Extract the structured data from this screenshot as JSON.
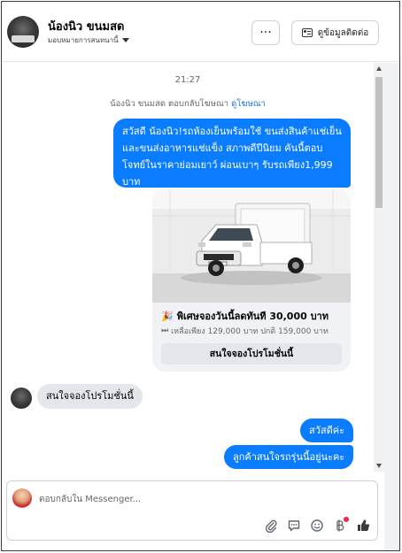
{
  "header": {
    "page_name": "น้องนิว ขนมสด",
    "page_subtitle": "มอบหมายการสนทนานี้",
    "more_label": "···",
    "contact_label": "ดูข้อมูลติดต่อ"
  },
  "chat": {
    "timestamp": "21:27",
    "replied_prefix": "น้องนิว ขนมสด ตอบกลับโฆษณา",
    "replied_link": "ดูโฆษณา",
    "outgoing_1": "สวัสดี น้องนิว!รถห้องเย็นพร้อมใช้ ขนส่งสินค้าแช่เย็นและขนส่งอาหารแช่แข็ง สภาพดีปีนิยม คันนี้ตอบโจทย์ในราคาย่อมเยาว์ ผ่อนเบาๆ รับรถเพียง1,999 บาท",
    "promo": {
      "title_emoji": "🎉",
      "title": "พิเศษจองวันนี้ลดทันที 30,000 บาท",
      "sub_emoji": "⏭",
      "subtitle": "เหลือเพียง 129,000 บาท ปกติ 159,000 บาท",
      "button": "สนใจจองโปรโมชั่นนี้"
    },
    "incoming_1": "สนใจจองโปรโมชั่นนี้",
    "outgoing_2": "สวัสดีค่ะ",
    "outgoing_3": "ลูกค้าสนใจรถรุ่นนี้อยู่นะคะ"
  },
  "composer": {
    "placeholder": "ตอบกลับใน Messenger..."
  },
  "colors": {
    "accent": "#0a7cff",
    "incoming_bubble": "#e4e6eb",
    "card_bg": "#f0f2f5",
    "link": "#216fdb",
    "notification": "#f02849"
  },
  "icons": [
    "ellipsis-icon",
    "contact-card-icon",
    "attachment-icon",
    "quick-reply-icon",
    "emoji-icon",
    "payment-icon",
    "thumbs-up-icon",
    "chevron-down-icon"
  ]
}
